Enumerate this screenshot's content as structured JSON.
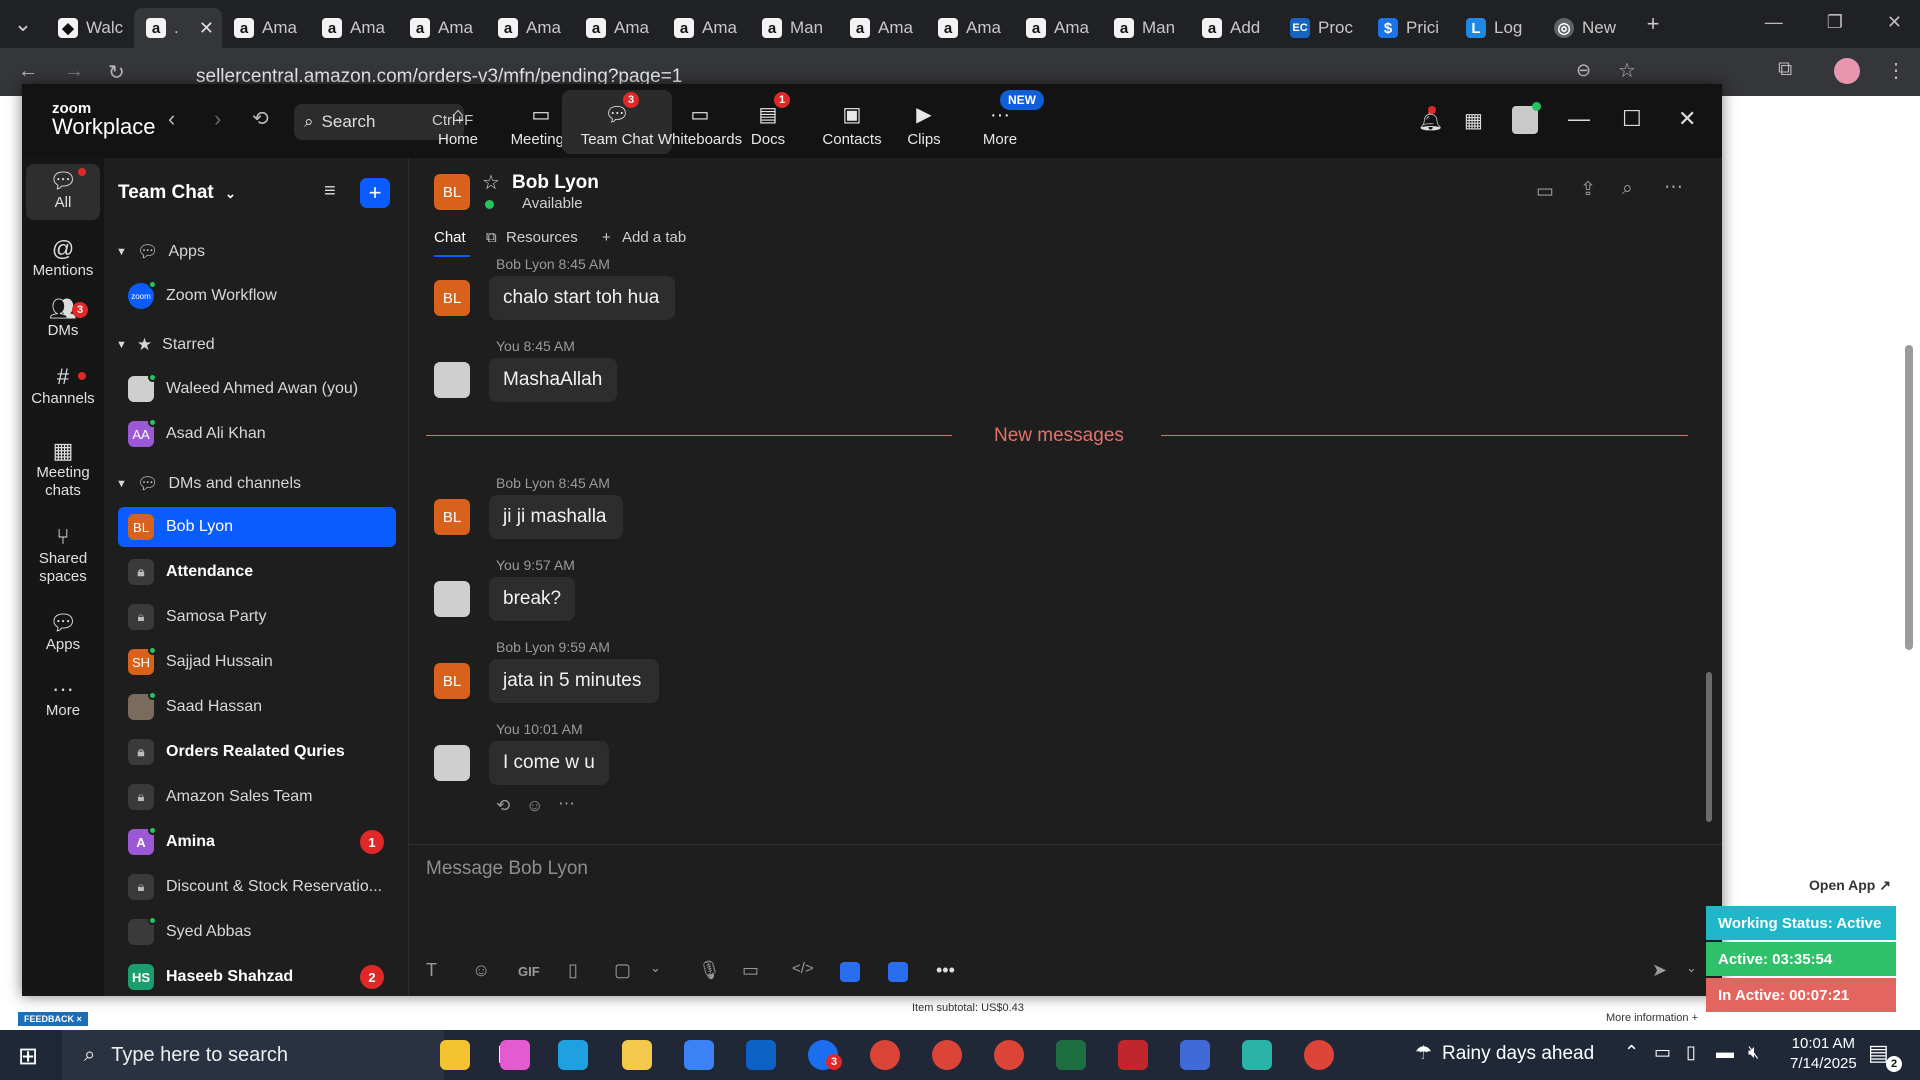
{
  "browser": {
    "tabs": [
      {
        "label": "Walc",
        "icon": "teal-diamond-icon"
      },
      {
        "label": ".",
        "icon": "amazon-icon",
        "active": true
      },
      {
        "label": "Ama",
        "icon": "amazon-icon"
      },
      {
        "label": "Ama",
        "icon": "amazon-icon"
      },
      {
        "label": "Ama",
        "icon": "amazon-icon"
      },
      {
        "label": "Ama",
        "icon": "amazon-icon"
      },
      {
        "label": "Ama",
        "icon": "amazon-icon"
      },
      {
        "label": "Ama",
        "icon": "amazon-icon"
      },
      {
        "label": "Man",
        "icon": "amazon-icon"
      },
      {
        "label": "Ama",
        "icon": "amazon-icon"
      },
      {
        "label": "Ama",
        "icon": "amazon-icon"
      },
      {
        "label": "Ama",
        "icon": "amazon-icon"
      },
      {
        "label": "Man",
        "icon": "amazon-icon"
      },
      {
        "label": "Add",
        "icon": "amazon-icon"
      },
      {
        "label": "Proc",
        "icon": "ec-icon"
      },
      {
        "label": "Prici",
        "icon": "dollar-icon"
      },
      {
        "label": "Log",
        "icon": "log-icon"
      },
      {
        "label": "New",
        "icon": "chrome-new-icon"
      }
    ],
    "url": "sellercentral.amazon.com/orders-v3/mfn/pending?page=1"
  },
  "zoom": {
    "logo_top": "zoom",
    "logo_bottom": "Workplace",
    "search_label": "Search",
    "search_shortcut": "Ctrl+F",
    "nav": [
      {
        "label": "Home",
        "icon": "home-icon"
      },
      {
        "label": "Meetings",
        "icon": "camera-icon"
      },
      {
        "label": "Team Chat",
        "icon": "chat-icon",
        "badge": "3"
      },
      {
        "label": "Whiteboards",
        "icon": "whiteboard-icon"
      },
      {
        "label": "Docs",
        "icon": "docs-icon",
        "badge": "1"
      },
      {
        "label": "Contacts",
        "icon": "contacts-icon"
      },
      {
        "label": "Clips",
        "icon": "clips-icon"
      },
      {
        "label": "More",
        "icon": "more-icon",
        "new_label": "NEW"
      }
    ]
  },
  "rail": [
    {
      "label": "All"
    },
    {
      "label": "Mentions"
    },
    {
      "label": "DMs",
      "badge": "3"
    },
    {
      "label": "Channels"
    },
    {
      "label": "Meeting chats"
    },
    {
      "label": "Shared spaces"
    },
    {
      "label": "Apps"
    },
    {
      "label": "More"
    }
  ],
  "sidebar": {
    "title": "Team Chat",
    "sections": {
      "apps": "Apps",
      "starred": "Starred",
      "dms": "DMs and channels"
    },
    "apps_items": [
      {
        "name": "Zoom Workflow",
        "avatar": "zoom"
      }
    ],
    "starred_items": [
      {
        "name": "Waleed Ahmed Awan (you)"
      },
      {
        "name": "Asad Ali Khan",
        "initials": "AA"
      }
    ],
    "dm_items": [
      {
        "name": "Bob Lyon",
        "initials": "BL"
      },
      {
        "name": "Attendance"
      },
      {
        "name": "Samosa Party"
      },
      {
        "name": "Sajjad Hussain",
        "initials": "SH"
      },
      {
        "name": "Saad Hassan"
      },
      {
        "name": "Orders Realated Quries"
      },
      {
        "name": "Amazon Sales Team"
      },
      {
        "name": "Amina",
        "initials": "A",
        "unread": "1"
      },
      {
        "name": "Discount & Stock Reservatio..."
      },
      {
        "name": "Syed Abbas"
      },
      {
        "name": "Haseeb Shahzad",
        "initials": "HS",
        "unread": "2"
      }
    ]
  },
  "chat": {
    "contact_initials": "BL",
    "contact_name": "Bob Lyon",
    "contact_status": "Available",
    "tabs": {
      "chat": "Chat",
      "resources": "Resources",
      "add": "Add a tab"
    },
    "messages": [
      {
        "meta": "Bob Lyon 8:45 AM",
        "text": "chalo start toh hua",
        "sender": "bob"
      },
      {
        "meta": "You 8:45 AM",
        "text": "MashaAllah",
        "sender": "me"
      },
      {
        "meta": "Bob Lyon 8:45 AM",
        "text": "ji ji mashalla",
        "sender": "bob"
      },
      {
        "meta": "You 9:57 AM",
        "text": "break?",
        "sender": "me"
      },
      {
        "meta": "Bob Lyon 9:59 AM",
        "text": "jata in 5 minutes",
        "sender": "bob"
      },
      {
        "meta": "You 10:01 AM",
        "text": "I come w u",
        "sender": "me"
      }
    ],
    "divider": "New messages",
    "composer_placeholder": "Message Bob Lyon",
    "gif_label": "GIF"
  },
  "widgets": {
    "open_app": "Open App ↗",
    "working_status": "Working Status: Active",
    "active_time": "Active: 03:35:54",
    "inactive_time": "In Active: 00:07:21",
    "colors": {
      "status": "#1fb7c9",
      "active": "#30c06a",
      "inactive": "#e2665f"
    }
  },
  "page_behind": {
    "feedback": "FEEDBACK ×",
    "subtotal": "Item subtotal: US$0.43",
    "more_info": "More information +"
  },
  "taskbar": {
    "search_placeholder": "Type here to search",
    "weather": "Rainy days ahead",
    "time": "10:01 AM",
    "date": "7/14/2025",
    "zoom_badge": "3",
    "notif_badge": "2"
  }
}
